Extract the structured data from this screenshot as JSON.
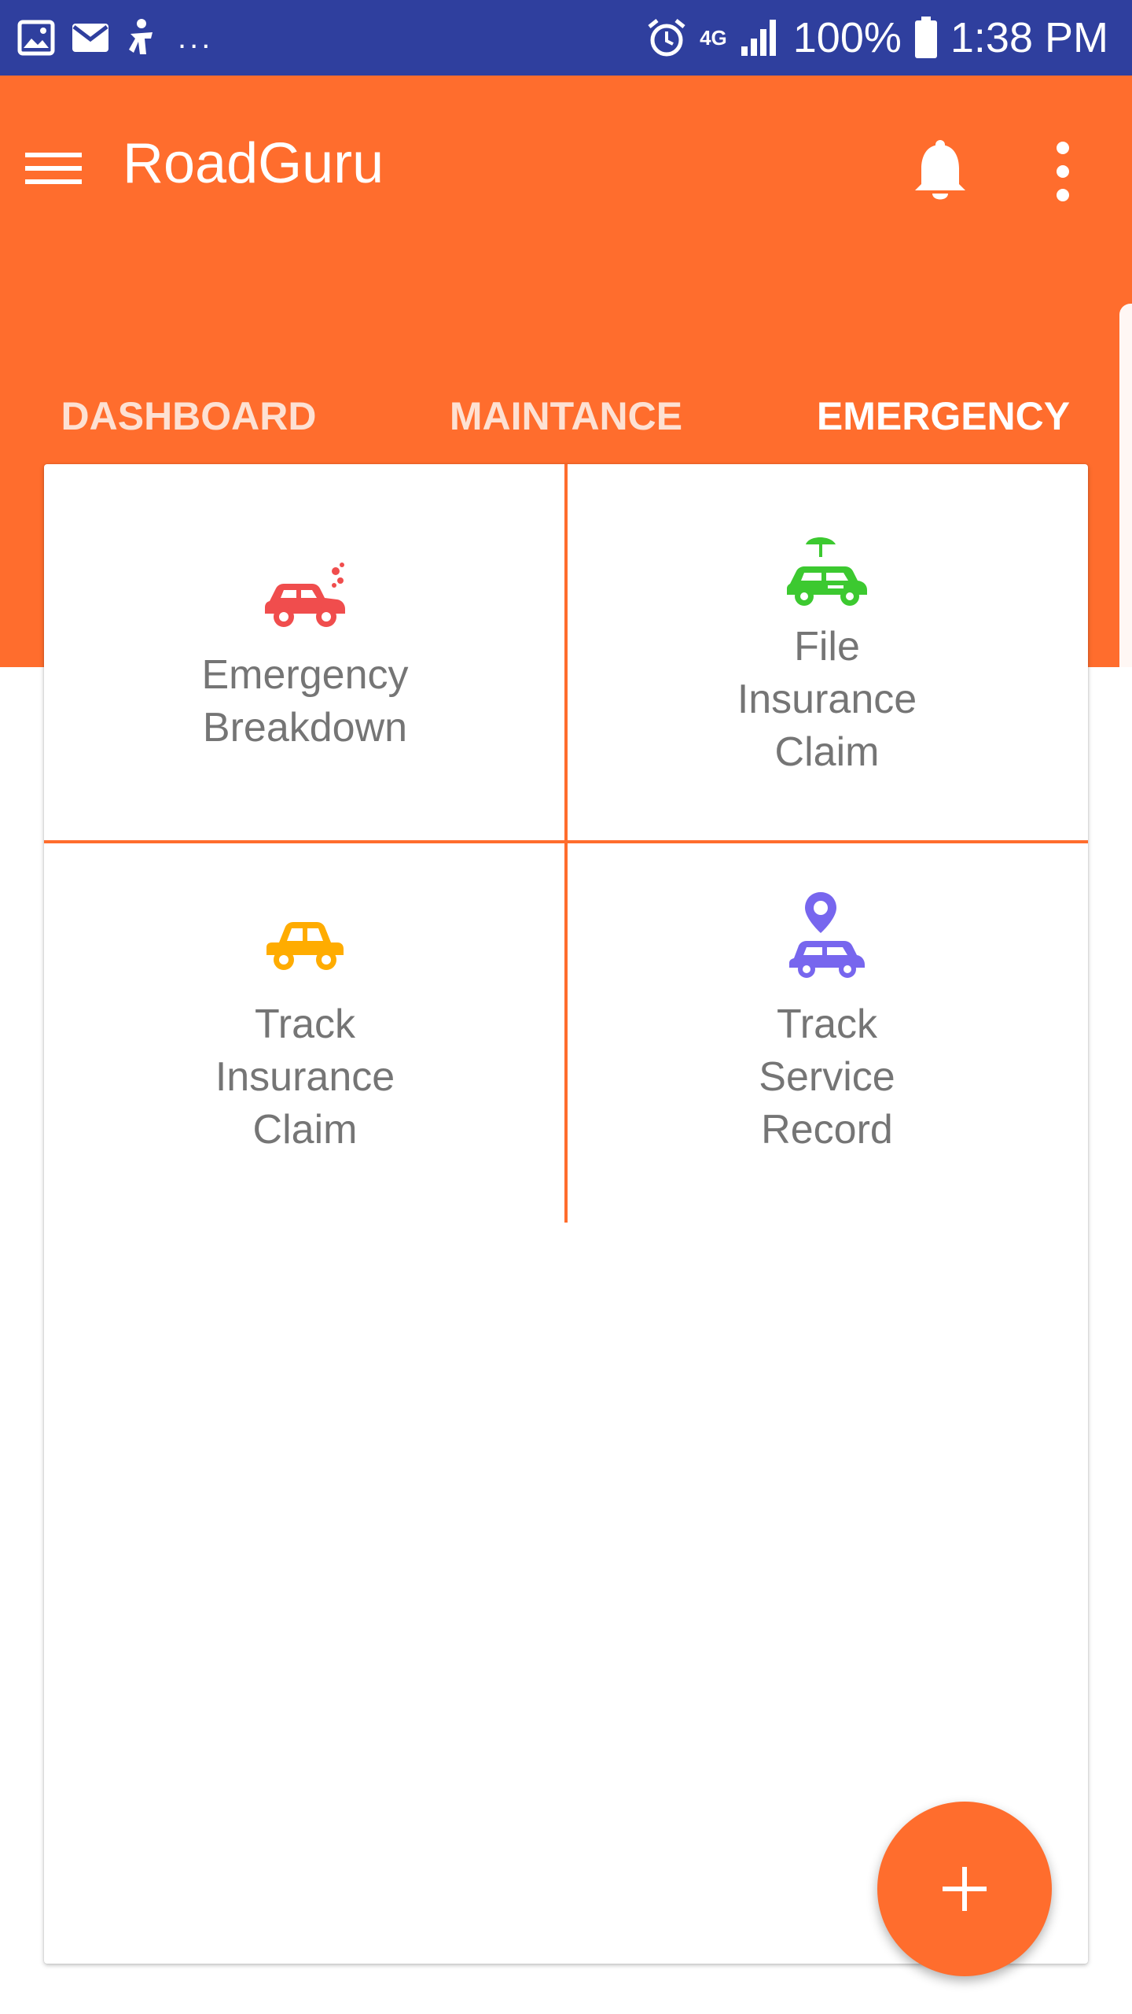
{
  "status_bar": {
    "left_icons": [
      "image-icon",
      "mail-icon",
      "accessibility-icon"
    ],
    "more_indicator": "...",
    "network_label": "4G",
    "battery": "100%",
    "time": "1:38 PM"
  },
  "app_bar": {
    "title": "RoadGuru",
    "icons": [
      "menu-icon",
      "bell-icon",
      "more-vert-icon"
    ],
    "background_color": "#ff6d2d"
  },
  "tabs": [
    {
      "label": "DASHBOARD",
      "selected": false
    },
    {
      "label": "MAINTANCE",
      "selected": false
    },
    {
      "label": "EMERGENCY",
      "selected": true
    }
  ],
  "grid_items": [
    {
      "label_lines": [
        "Emergency",
        "Breakdown"
      ],
      "icon": "car-breakdown-icon",
      "icon_color": "#f04d4d"
    },
    {
      "label_lines": [
        "File",
        "Insurance",
        "Claim"
      ],
      "icon": "car-umbrella-icon",
      "icon_color": "#3cc930"
    },
    {
      "label_lines": [
        "Track",
        "Insurance",
        "Claim"
      ],
      "icon": "car-icon",
      "icon_color": "#ffac00"
    },
    {
      "label_lines": [
        "Track",
        "Service",
        "Record"
      ],
      "icon": "car-location-icon",
      "icon_color": "#7766ee"
    }
  ],
  "fab": {
    "label": "+",
    "icon": "add-icon"
  },
  "colors": {
    "accent": "#ff6d2d",
    "status_bar": "#2f3f9e",
    "label_text": "#757575"
  }
}
